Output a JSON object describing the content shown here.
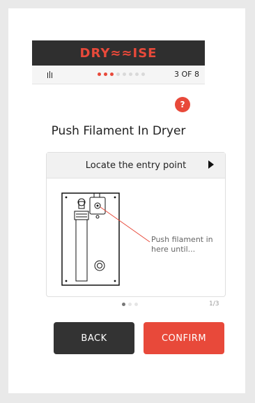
{
  "brand": "DRY≈≈ISE",
  "progress": {
    "step_text": "3 OF 8",
    "current_step": 3,
    "total_steps": 8
  },
  "help_label": "?",
  "title": "Push Filament In Dryer",
  "card": {
    "heading": "Locate the entry point",
    "note": "Push filament in here until...",
    "page_indicator": "1/3",
    "current_page": 1,
    "total_pages": 3
  },
  "buttons": {
    "back": "BACK",
    "confirm": "CONFIRM"
  },
  "colors": {
    "accent": "#e8493a",
    "header_bg": "#2f2f2f",
    "back_btn": "#333333"
  }
}
